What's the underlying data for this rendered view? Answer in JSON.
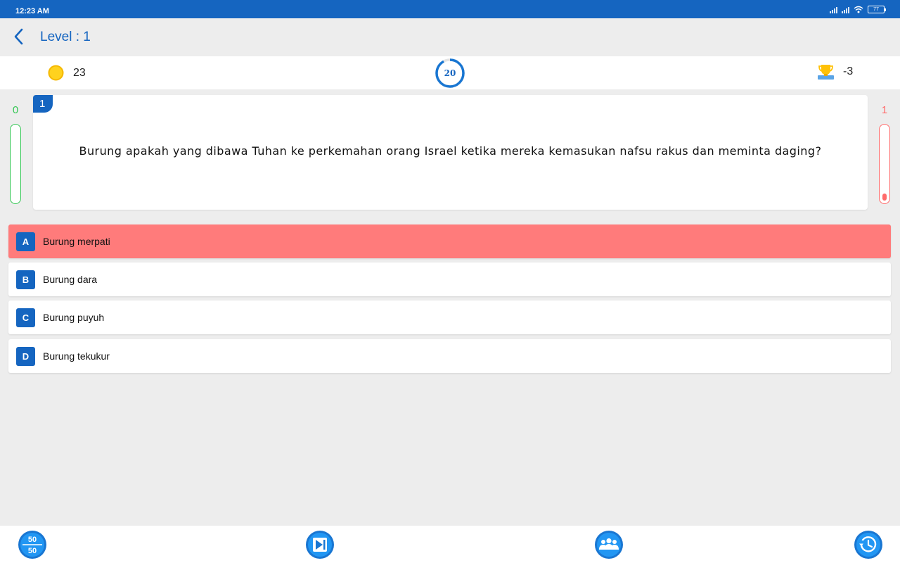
{
  "status_bar": {
    "time": "12:23 AM",
    "battery": "77"
  },
  "header": {
    "title": "Level : 1",
    "back_icon": "chevron-left-icon"
  },
  "stats": {
    "coins": "23",
    "timer": "20",
    "timer_progress": 0.92,
    "score": "-3"
  },
  "meters": {
    "correct_count": "0",
    "wrong_count": "1",
    "correct_fill": 0,
    "wrong_fill": 0.1
  },
  "question": {
    "number": "1",
    "text": "Burung apakah yang dibawa Tuhan ke perkemahan orang Israel ketika mereka kemasukan nafsu rakus dan meminta daging?"
  },
  "options": [
    {
      "letter": "A",
      "text": "Burung merpati",
      "state": "wrong"
    },
    {
      "letter": "B",
      "text": "Burung dara",
      "state": "normal"
    },
    {
      "letter": "C",
      "text": "Burung puyuh",
      "state": "normal"
    },
    {
      "letter": "D",
      "text": "Burung tekukur",
      "state": "normal"
    }
  ],
  "lifelines": {
    "fifty_fifty": {
      "top": "50",
      "bottom": "50",
      "icon": "fifty-fifty-icon"
    },
    "skip": {
      "icon": "skip-icon"
    },
    "audience": {
      "icon": "audience-icon"
    },
    "time": {
      "icon": "history-icon"
    }
  },
  "colors": {
    "primary": "#1565c0",
    "correct": "#33c653",
    "wrong": "#ff6b6b",
    "wrong_option": "#ff7b7b",
    "coin": "#ffd21e"
  }
}
